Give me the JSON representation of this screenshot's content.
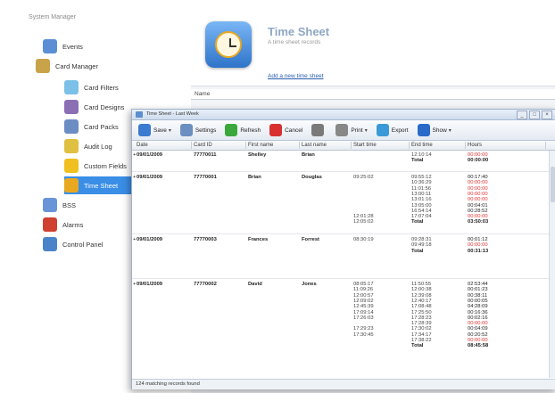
{
  "tree": {
    "root_label": "System Manager",
    "items": [
      {
        "label": "Events",
        "color": "#5a8fd6"
      },
      {
        "label": "Card Manager",
        "color": "#c8a34a"
      },
      {
        "label": "Card Filters",
        "color": "#7cc0e8"
      },
      {
        "label": "Card Designs",
        "color": "#8b6fb5"
      },
      {
        "label": "Card Packs",
        "color": "#6c8cc4"
      },
      {
        "label": "Audit Log",
        "color": "#e0c040"
      },
      {
        "label": "Custom Fields",
        "color": "#f0c020"
      },
      {
        "label": "Time Sheet",
        "color": "#e8a820"
      },
      {
        "label": "BSS",
        "color": "#6a94d8"
      },
      {
        "label": "Alarms",
        "color": "#d04030"
      },
      {
        "label": "Control Panel",
        "color": "#4a84c8"
      }
    ]
  },
  "main": {
    "title": "Time Sheet",
    "description": "A time sheet records",
    "add_link": "Add a new time sheet",
    "name_col": "Name"
  },
  "window": {
    "title": "Time Sheet - Last Week",
    "controls": [
      "_",
      "□",
      "×"
    ],
    "toolbar": [
      {
        "label": "Save",
        "dropdown": true,
        "icon": "save-icon",
        "color": "#3a7ad0"
      },
      {
        "label": "Settings",
        "dropdown": false,
        "icon": "settings-icon",
        "color": "#6a8fc0"
      },
      {
        "label": "Refresh",
        "dropdown": false,
        "icon": "refresh-icon",
        "color": "#3aa83a"
      },
      {
        "label": "Cancel",
        "dropdown": false,
        "icon": "cancel-icon",
        "color": "#d83030"
      },
      {
        "label": "",
        "dropdown": false,
        "icon": "print-preview-icon",
        "color": "#7a7a7a"
      },
      {
        "label": "Print",
        "dropdown": true,
        "icon": "print-icon",
        "color": "#888888"
      },
      {
        "label": "Export",
        "dropdown": false,
        "icon": "export-icon",
        "color": "#3a9ad8"
      },
      {
        "label": "Show",
        "dropdown": true,
        "icon": "help-icon",
        "color": "#2a6ac8"
      }
    ],
    "columns": [
      "Date",
      "Card ID",
      "First name",
      "Last name",
      "Start time",
      "End time",
      "Hours"
    ],
    "records": [
      {
        "date": "09/01/2009",
        "card": "77770011",
        "first": "Shelley",
        "last": "Brian",
        "start": [],
        "end": [
          "12:10:14"
        ],
        "hours": [
          "00:00:00"
        ],
        "total": "00:00:00"
      },
      {
        "date": "09/01/2009",
        "card": "77770001",
        "first": "Brian",
        "last": "Douglas",
        "start": [
          "09:25:02",
          "",
          "",
          "",
          "",
          "",
          "",
          "12:01:28",
          "12:05:02"
        ],
        "end": [
          "09:55:12",
          "10:36:29",
          "11:01:56",
          "13:00:11",
          "13:01:16",
          "13:05:00",
          "16:54:14",
          "17:07:04"
        ],
        "hours": [
          "00:17:40",
          "00:00:00",
          "00:00:00",
          "00:00:00",
          "00:00:00",
          "00:04:01",
          "00:28:52",
          "00:00:00"
        ],
        "total": "03:50:03"
      },
      {
        "date": "09/01/2009",
        "card": "77770003",
        "first": "Frances",
        "last": "Forrest",
        "start": [
          "08:30:19"
        ],
        "end": [
          "09:28:31",
          "09:49:18"
        ],
        "hours": [
          "00:01:12",
          "00:00:00"
        ],
        "total": "00:31:13"
      },
      {
        "date": "09/01/2009",
        "card": "77770002",
        "first": "David",
        "last": "Jones",
        "start": [
          "08:05:17",
          "11:09:26",
          "12:00:57",
          "12:09:02",
          "12:45:39",
          "17:09:14",
          "17:26:03",
          "",
          "17:29:23",
          "17:30:45"
        ],
        "end": [
          "11:50:55",
          "12:00:38",
          "12:39:08",
          "12:40:17",
          "17:08:48",
          "17:25:50",
          "17:28:23",
          "17:28:39",
          "17:30:02",
          "17:34:17",
          "17:38:22"
        ],
        "hours": [
          "02:53:44",
          "00:01:23",
          "00:38:11",
          "00:00:05",
          "04:28:09",
          "00:16:36",
          "00:02:16",
          "00:00:00",
          "00:04:09",
          "00:20:52",
          "00:00:00"
        ],
        "total": "08:45:58"
      }
    ],
    "total_label": "Total",
    "status": "124 matching records found"
  }
}
